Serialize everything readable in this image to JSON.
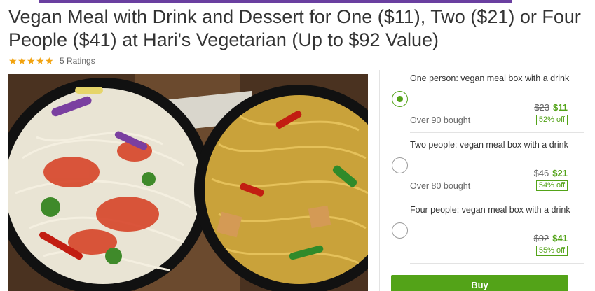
{
  "deal": {
    "title": "Vegan Meal with Drink and Dessert for One ($11), Two ($21) or Four People ($41) at Hari's Vegetarian (Up to $92 Value)",
    "rating_stars": 5,
    "ratings_label": "5 Ratings"
  },
  "options": [
    {
      "title": "One person: vegan meal box with a drink",
      "original_price": "$23",
      "price": "$11",
      "discount": "52% off",
      "bought": "Over 90 bought",
      "selected": true
    },
    {
      "title": "Two people: vegan meal box with a drink",
      "original_price": "$46",
      "price": "$21",
      "discount": "54% off",
      "bought": "Over 80 bought",
      "selected": false
    },
    {
      "title": "Four people: vegan meal box with a drink",
      "original_price": "$92",
      "price": "$41",
      "discount": "55% off",
      "bought": "",
      "selected": false
    }
  ],
  "buy_label": "Buy",
  "colors": {
    "accent_green": "#53a318",
    "top_bar_purple": "#6a3fa0",
    "star_orange": "#f2a30f"
  },
  "icons": {
    "star": "star-icon",
    "radio": "radio-button"
  }
}
